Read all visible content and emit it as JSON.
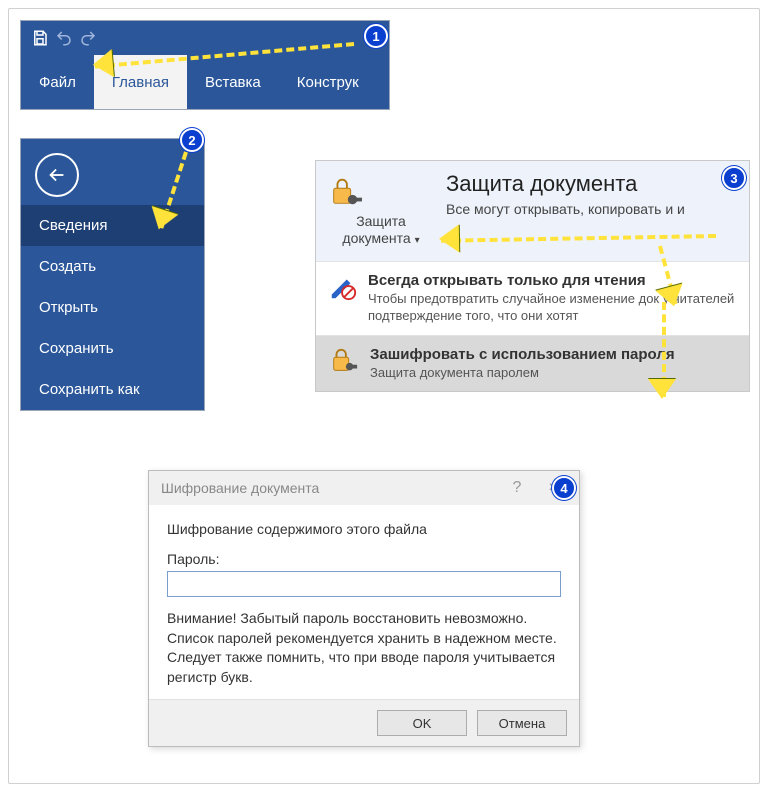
{
  "ribbon": {
    "tabs": [
      "Файл",
      "Главная",
      "Вставка",
      "Конструк"
    ],
    "active_index": 1
  },
  "backstage": {
    "items": [
      "Сведения",
      "Создать",
      "Открыть",
      "Сохранить",
      "Сохранить как"
    ],
    "selected_index": 0
  },
  "protect": {
    "button_label": "Защита документа",
    "heading": "Защита документа",
    "subheading": "Все могут открывать, копировать и и",
    "options": [
      {
        "title": "Всегда открывать только для чтения",
        "sub": "Чтобы предотвратить случайное изменение док\nу читателей подтверждение того, что они хотят"
      },
      {
        "title": "Зашифровать с использованием пароля",
        "sub": "Защита документа паролем"
      }
    ],
    "selected_option": 1
  },
  "dialog": {
    "title": "Шифрование документа",
    "heading": "Шифрование содержимого этого файла",
    "password_label": "Пароль:",
    "password_value": "",
    "warning": "Внимание! Забытый пароль восстановить невозможно. Список паролей рекомендуется хранить в надежном месте.\nСледует также помнить, что при вводе пароля учитывается регистр букв.",
    "ok": "OK",
    "cancel": "Отмена"
  },
  "badges": {
    "1": "1",
    "2": "2",
    "3": "3",
    "4": "4"
  }
}
